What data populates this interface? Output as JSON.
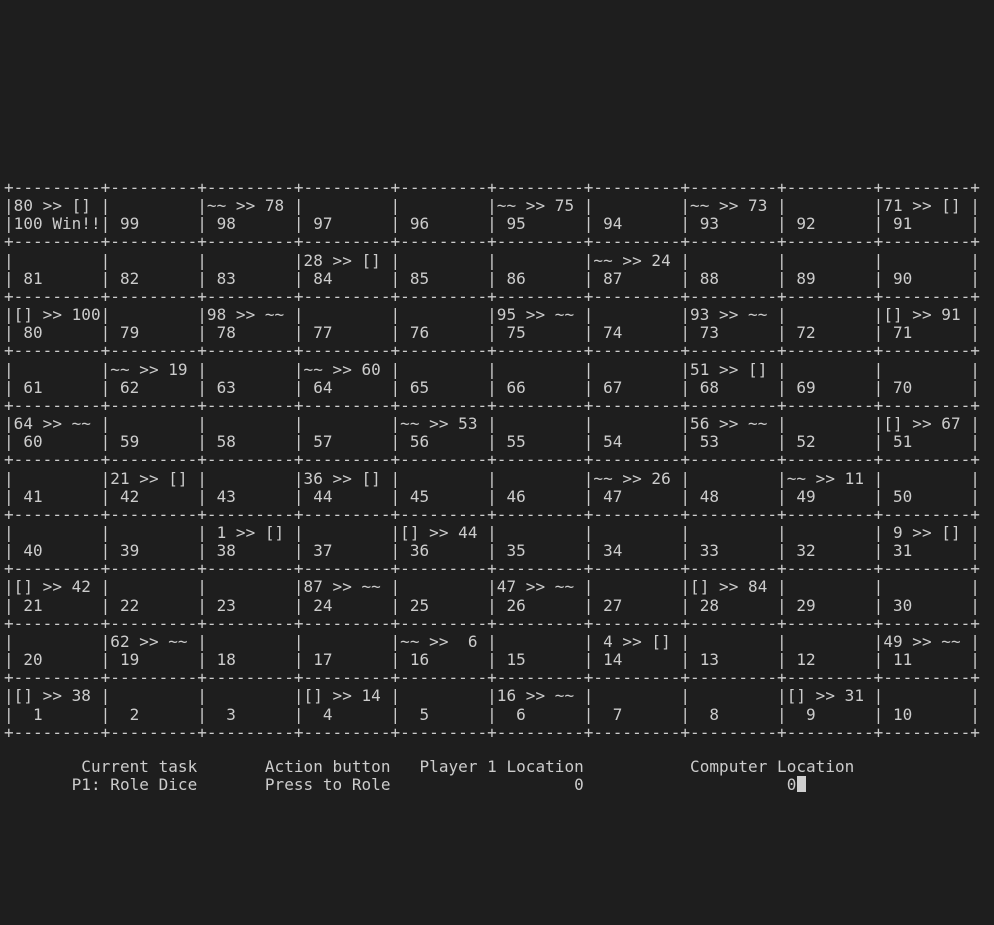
{
  "terminal": {
    "board_lines": [
      "+---------+---------+---------+---------+---------+---------+---------+---------+---------+---------+",
      "|80 >> [] |         |~~ >> 78 |         |         |~~ >> 75 |         |~~ >> 73 |         |71 >> [] |",
      "|100 Win!!| 99      | 98      | 97      | 96      | 95      | 94      | 93      | 92      | 91      |",
      "+---------+---------+---------+---------+---------+---------+---------+---------+---------+---------+",
      "|         |         |         |28 >> [] |         |         |~~ >> 24 |         |         |         |",
      "| 81      | 82      | 83      | 84      | 85      | 86      | 87      | 88      | 89      | 90      |",
      "+---------+---------+---------+---------+---------+---------+---------+---------+---------+---------+",
      "|[] >> 100|         |98 >> ~~ |         |         |95 >> ~~ |         |93 >> ~~ |         |[] >> 91 |",
      "| 80      | 79      | 78      | 77      | 76      | 75      | 74      | 73      | 72      | 71      |",
      "+---------+---------+---------+---------+---------+---------+---------+---------+---------+---------+",
      "|         |~~ >> 19 |         |~~ >> 60 |         |         |         |51 >> [] |         |         |",
      "| 61      | 62      | 63      | 64      | 65      | 66      | 67      | 68      | 69      | 70      |",
      "+---------+---------+---------+---------+---------+---------+---------+---------+---------+---------+",
      "|64 >> ~~ |         |         |         |~~ >> 53 |         |         |56 >> ~~ |         |[] >> 67 |",
      "| 60      | 59      | 58      | 57      | 56      | 55      | 54      | 53      | 52      | 51      |",
      "+---------+---------+---------+---------+---------+---------+---------+---------+---------+---------+",
      "|         |21 >> [] |         |36 >> [] |         |         |~~ >> 26 |         |~~ >> 11 |         |",
      "| 41      | 42      | 43      | 44      | 45      | 46      | 47      | 48      | 49      | 50      |",
      "+---------+---------+---------+---------+---------+---------+---------+---------+---------+---------+",
      "|         |         | 1 >> [] |         |[] >> 44 |         |         |         |         | 9 >> [] |",
      "| 40      | 39      | 38      | 37      | 36      | 35      | 34      | 33      | 32      | 31      |",
      "+---------+---------+---------+---------+---------+---------+---------+---------+---------+---------+",
      "|[] >> 42 |         |         |87 >> ~~ |         |47 >> ~~ |         |[] >> 84 |         |         |",
      "| 21      | 22      | 23      | 24      | 25      | 26      | 27      | 28      | 29      | 30      |",
      "+---------+---------+---------+---------+---------+---------+---------+---------+---------+---------+",
      "|         |62 >> ~~ |         |         |~~ >>  6 |         | 4 >> [] |         |         |49 >> ~~ |",
      "| 20      | 19      | 18      | 17      | 16      | 15      | 14      | 13      | 12      | 11      |",
      "+---------+---------+---------+---------+---------+---------+---------+---------+---------+---------+",
      "|[] >> 38 |         |         |[] >> 14 |         |16 >> ~~ |         |         |[] >> 31 |         |",
      "|  1      |  2      |  3      |  4      |  5      |  6      |  7      |  8      |  9      | 10      |",
      "+---------+---------+---------+---------+---------+---------+---------+---------+---------+---------+"
    ],
    "status_line_1": "        Current task       Action button   Player 1 Location           Computer Location",
    "status_line_2": "       P1: Role Dice       Press to Role                   0                     0",
    "colors": {
      "background": "#1e1e1e",
      "text": "#cccccc",
      "cursor": "#cfcfcf"
    }
  }
}
